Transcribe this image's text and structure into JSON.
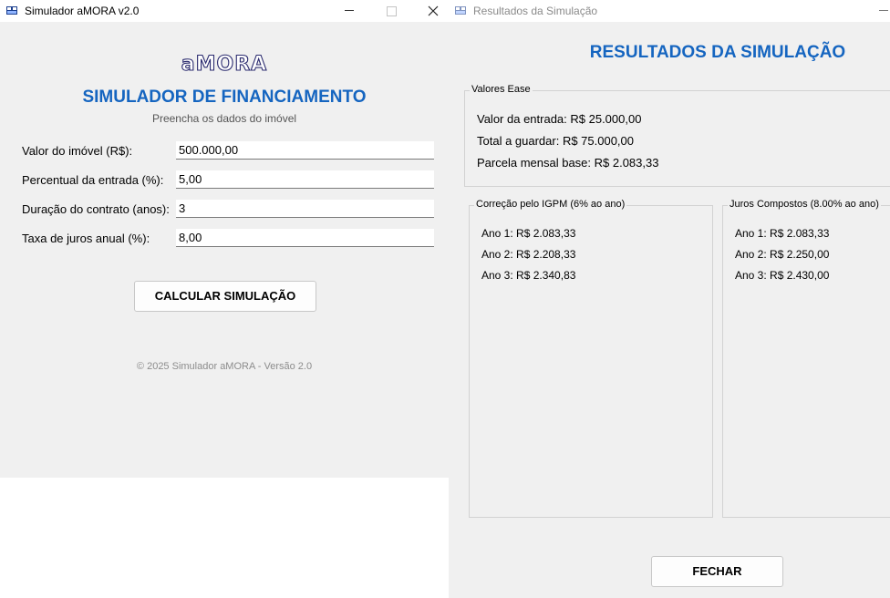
{
  "simulator": {
    "window_title": "Simulador aMORA v2.0",
    "logo_text": "aMORA",
    "title": "SIMULADOR DE FINANCIAMENTO",
    "subtitle": "Preencha os dados do imóvel",
    "fields": [
      {
        "label": "Valor do imóvel (R$):",
        "value": "500.000,00"
      },
      {
        "label": "Percentual da entrada (%):",
        "value": "5,00"
      },
      {
        "label": "Duração do contrato (anos):",
        "value": "3"
      },
      {
        "label": "Taxa de juros anual (%):",
        "value": "8,00"
      }
    ],
    "calculate_label": "CALCULAR SIMULAÇÃO",
    "footer": "© 2025 Simulador aMORA - Versão 2.0"
  },
  "results": {
    "window_title": "Resultados da Simulação",
    "title": "RESULTADOS DA SIMULAÇÃO",
    "base_values": {
      "legend": "Valores Ease",
      "lines": [
        "Valor da entrada: R$ 25.000,00",
        "Total a guardar: R$ 75.000,00",
        "Parcela mensal base: R$ 2.083,33"
      ]
    },
    "igpm": {
      "legend": "Correção pelo IGPM (6% ao ano)",
      "lines": [
        "Ano 1: R$ 2.083,33",
        "Ano 2: R$ 2.208,33",
        "Ano 3: R$ 2.340,83"
      ]
    },
    "compound": {
      "legend": "Juros Compostos (8.00% ao ano)",
      "lines": [
        "Ano 1: R$ 2.083,33",
        "Ano 2: R$ 2.250,00",
        "Ano 3: R$ 2.430,00"
      ]
    },
    "close_label": "FECHAR"
  },
  "icons": {
    "app_icon": "window-app-icon",
    "minimize": "minimize-icon",
    "maximize": "maximize-icon",
    "close": "close-icon"
  },
  "colors": {
    "accent": "#1565c0",
    "window_bg": "#f0f0f0",
    "footer_text": "#8c8c8c"
  }
}
